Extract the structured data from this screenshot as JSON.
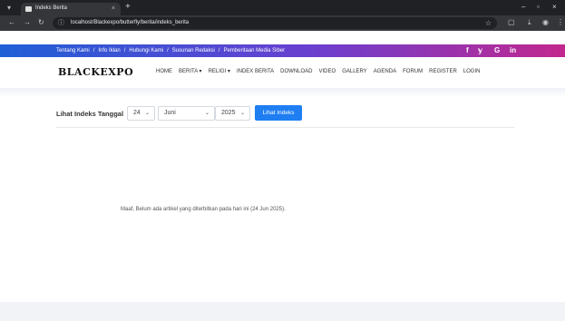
{
  "browser": {
    "tab_title": "Indeks Berita",
    "tab_close": "×",
    "new_tab": "+",
    "url": "localhost/Blackexpo/butterfly/berita/indeks_berita",
    "win_minimize": "–",
    "win_restore": "▫",
    "win_close": "×"
  },
  "topstrip": {
    "links": [
      "Tentang Kami",
      "Info Iklan",
      "Hubungi Kami",
      "Susunan Redaksi",
      "Pemberitaan Media Siber"
    ],
    "separator": "/",
    "social": [
      "f",
      "𝕪",
      "G",
      "in"
    ]
  },
  "header": {
    "logo": "BLACKEXPO",
    "menu": [
      "HOME",
      "BERITA ▾",
      "RELIGI ▾",
      "INDEX BERITA",
      "DOWNLOAD",
      "VIDEO",
      "GALLERY",
      "AGENDA",
      "FORUM",
      "REGISTER",
      "LOGIN"
    ]
  },
  "filter": {
    "label": "Lihat Indeks Tanggal",
    "day": "24",
    "month": "Juni",
    "year": "2025",
    "button": "Lihat Indeks"
  },
  "message": "Maaf, Belum ada artikel yang diterbitkan pada hari ini (24 Jun 2025)."
}
